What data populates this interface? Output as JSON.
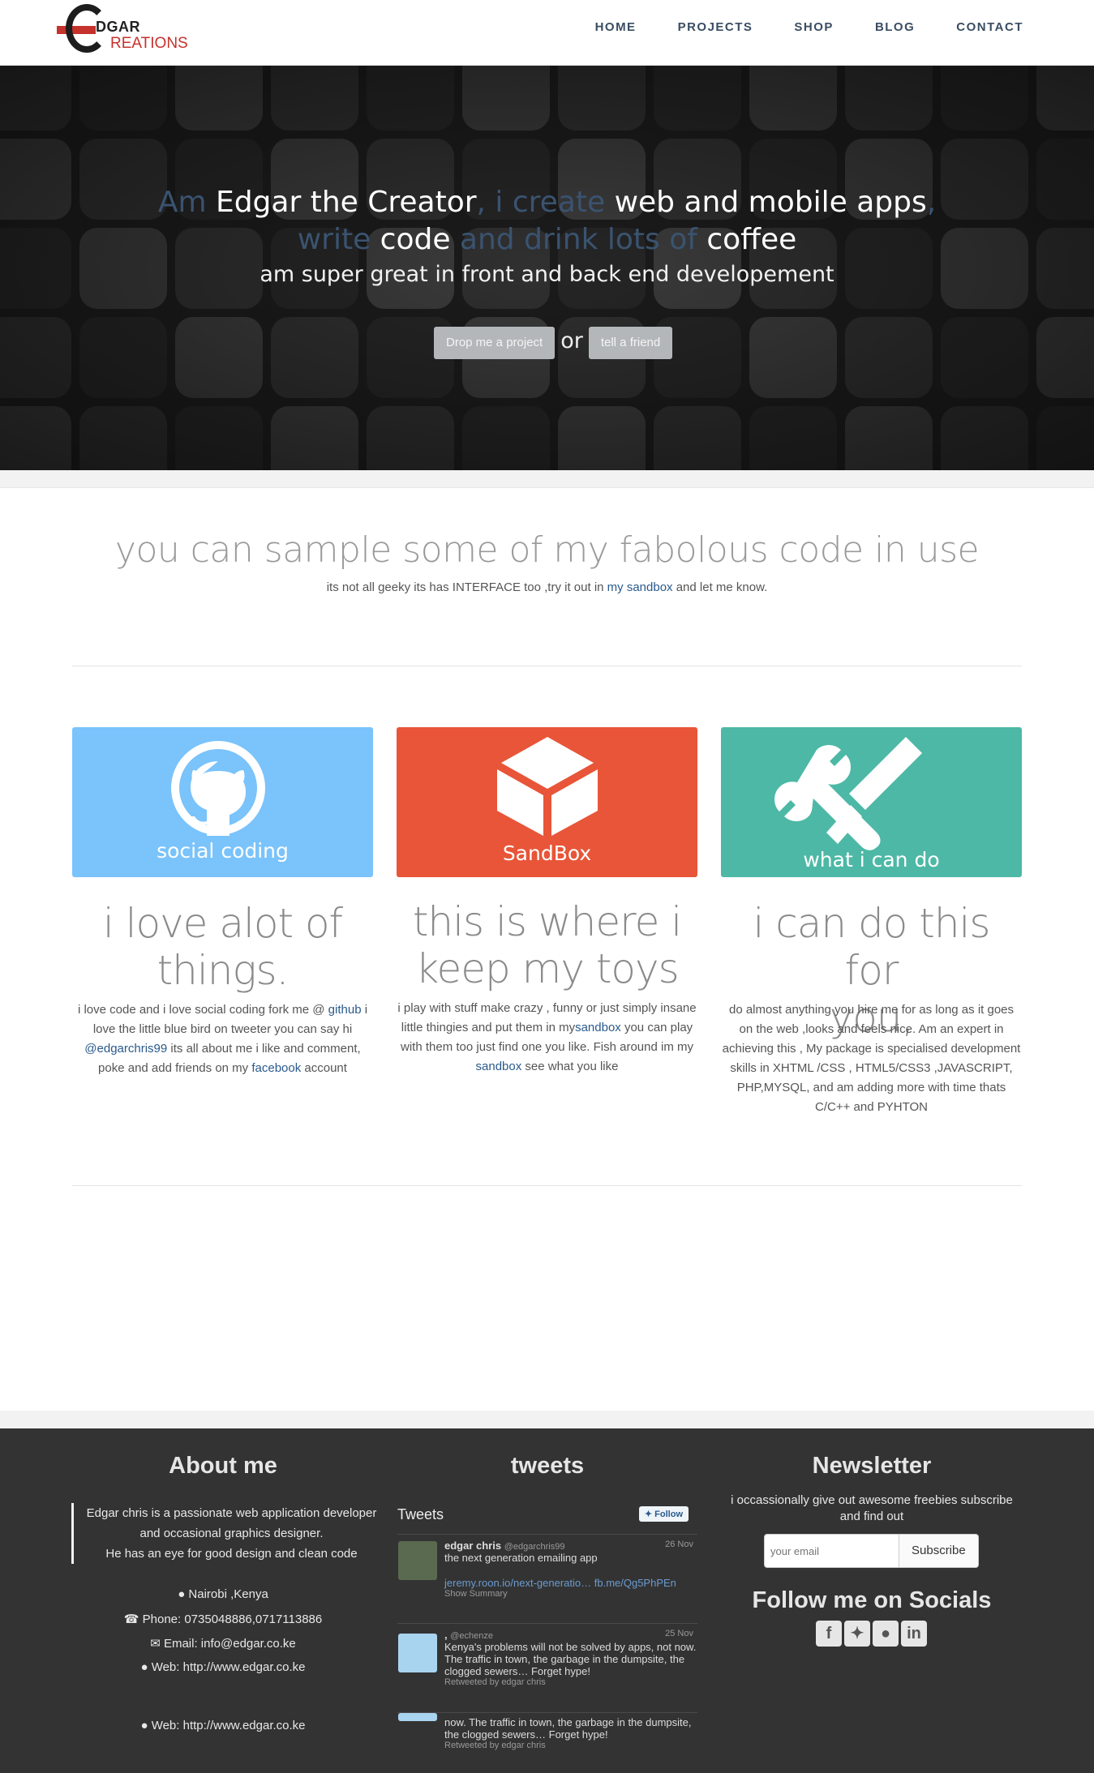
{
  "brand": {
    "line1": "DGAR",
    "line2": "REATIONS"
  },
  "nav": {
    "items": [
      "HOME",
      "PROJECTS",
      "SHOP",
      "BLOG",
      "CONTACT"
    ]
  },
  "hero": {
    "line1_a": "Am ",
    "line1_b": "Edgar the Creator",
    "line1_c": ", i create ",
    "line1_d": "web and mobile apps",
    "line1_e": ",",
    "line2_a": "write ",
    "line2_b": "code",
    "line2_c": " and drink lots of ",
    "line2_d": "coffee",
    "line3": "am super great in front and back end developement",
    "btn_project": "Drop me a project",
    "or": "or",
    "btn_friend": "tell a friend"
  },
  "sample": {
    "title": "you can sample some of my fabolous code in use",
    "sub_before": "its not all geeky its has INTERFACE too ,try it out in ",
    "sub_link": "my sandbox",
    "sub_after": " and let me know."
  },
  "features": [
    {
      "card_label": "social coding",
      "card_color": "#7ac3fb",
      "heading_1": "i love alot of",
      "heading_2": "things.",
      "text_1": "i love code and i love social coding fork me @ ",
      "link_1": "github",
      "text_2": " i love the little blue bird on tweeter you can say hi ",
      "link_2": "@edgarchris99",
      "text_3": " its all about me i like and comment, poke and add friends on my ",
      "link_3": "facebook",
      "text_4": " account"
    },
    {
      "card_label": "SandBox",
      "card_color": "#e85538",
      "heading_1": "this is where i",
      "heading_2": "keep my toys",
      "text_1": "i play with stuff make crazy , funny or just simply insane little thingies and put them in my",
      "link_1": "sandbox",
      "text_2": " you can play with them too just find one you like. Fish around im my ",
      "link_2": "sandbox",
      "text_3": " see what you like"
    },
    {
      "card_label": "what i can do",
      "card_color": "#4db8a6",
      "heading_1": "i can do this for",
      "heading_2": "you,",
      "text_1": "do almost anything you hire me for as long as it goes on the web ,looks and feels nice. Am an expert in achieving this , My package is specialised development skills in XHTML /CSS , HTML5/CSS3 ,JAVASCRIPT, PHP,MYSQL, and am adding more with time thats C/C++ and PYHTON"
    }
  ],
  "footer": {
    "about_title": "About me",
    "about_quote_1": "Edgar chris is a passionate web application developer and occasional graphics designer.",
    "about_quote_2": "He has an eye for good design and clean code",
    "location": "Nairobi ,Kenya",
    "phone": "Phone: 0735048886,0717113886",
    "email": "Email: info@edgar.co.ke",
    "web1": "Web: http://www.edgar.co.ke",
    "web2": "Web: http://www.edgar.co.ke",
    "tweets_title": "tweets",
    "tweets_head": "Tweets",
    "follow": "Follow",
    "tweets": [
      {
        "name": "edgar chris",
        "handle": "@edgarchris99",
        "time": "26 Nov",
        "text": "the next generation emailing app",
        "link": "jeremy.roon.io/next-generatio… fb.me/Qg5PhPEn",
        "extra": "Show Summary"
      },
      {
        "name": ",",
        "handle": "@echenze",
        "time": "25 Nov",
        "text": "Kenya's problems will not be solved by apps, not now. The traffic in town, the garbage in the dumpsite, the clogged sewers… Forget hype!",
        "extra": "Retweeted by edgar chris"
      },
      {
        "text": "now. The traffic in town, the garbage in the dumpsite, the clogged sewers… Forget hype!",
        "extra": "Retweeted by edgar chris"
      }
    ],
    "newsletter_title": "Newsletter",
    "newsletter_text": "i occassionally give out awesome freebies subscribe and find out",
    "newsletter_placeholder": "your email",
    "subscribe": "Subscribe",
    "socials_title": "Follow me on Socials",
    "socials": [
      "facebook-icon",
      "twitter-icon",
      "github-icon",
      "linkedin-icon"
    ]
  }
}
